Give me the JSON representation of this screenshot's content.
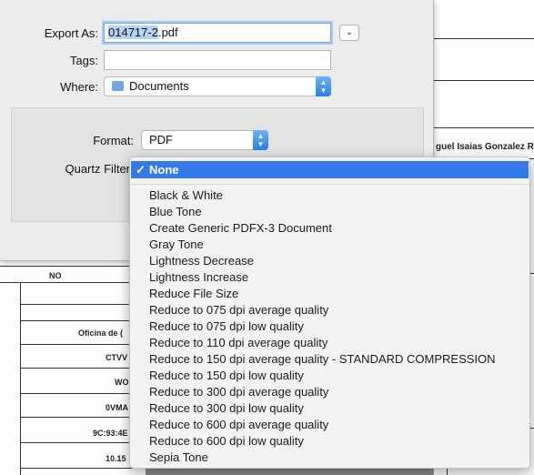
{
  "dialog": {
    "export_as_label": "Export As:",
    "filename_selected": "014717-2",
    "filename_ext": ".pdf",
    "tags_label": "Tags:",
    "where_label": "Where:",
    "where_value": "Documents",
    "format_label": "Format:",
    "format_value": "PDF",
    "quartz_filter_label": "Quartz Filter"
  },
  "menu": {
    "selected_item": "None",
    "items": [
      "Black & White",
      "Blue Tone",
      "Create Generic PDFX-3 Document",
      "Gray Tone",
      "Lightness Decrease",
      "Lightness Increase",
      "Reduce File Size",
      "Reduce to 075 dpi average quality",
      "Reduce to 075 dpi low quality",
      "Reduce to 110 dpi average quality",
      "Reduce to 150 dpi average quality - STANDARD COMPRESSION",
      "Reduce to 150 dpi low quality",
      "Reduce to 300 dpi average quality",
      "Reduce to 300 dpi low quality",
      "Reduce to 600 dpi average quality",
      "Reduce to 600 dpi low quality",
      "Sepia Tone"
    ]
  },
  "background_document": {
    "header_right": "guel Isaias Gonzalez Ra",
    "col_header": "NO",
    "cells": [
      "Oficina de (",
      "CTVV",
      "WO",
      "0VMA",
      "9C:93:4E",
      "10.15"
    ]
  }
}
